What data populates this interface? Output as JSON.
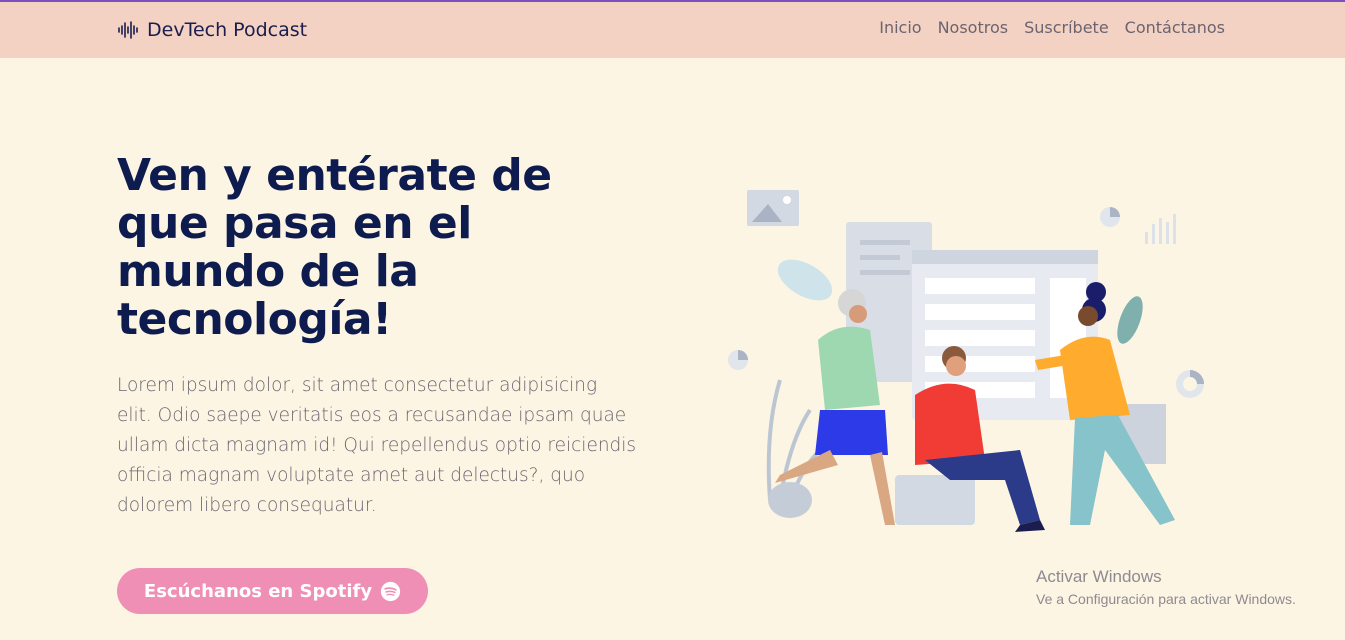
{
  "nav": {
    "brand": "DevTech Podcast",
    "brand_icon": "soundwave-icon",
    "links": [
      "Inicio",
      "Nosotros",
      "Suscríbete",
      "Contáctanos"
    ]
  },
  "hero": {
    "title": "Ven y entérate de que pasa en el mundo de la tecnología!",
    "text": "Lorem ipsum dolor, sit amet consectetur adipisicing elit. Odio saepe veritatis eos a recusandae ipsam quae ullam dicta magnam id! Qui repellendus optio reiciendis officia magnam voluptate amet aut delectus?, quo dolorem libero consequatur.",
    "cta_label": "Escúchanos en Spotify",
    "cta_icon": "spotify-icon",
    "illustration": "team-collaboration-illustration"
  },
  "watermark": {
    "title": "Activar Windows",
    "subtitle": "Ve a Configuración para activar Windows."
  },
  "colors": {
    "navbar": "#f3d2c3",
    "background": "#fdf5e3",
    "title": "#0d1b4f",
    "cta": "#f08fb5",
    "topline": "#7b4fc0"
  }
}
